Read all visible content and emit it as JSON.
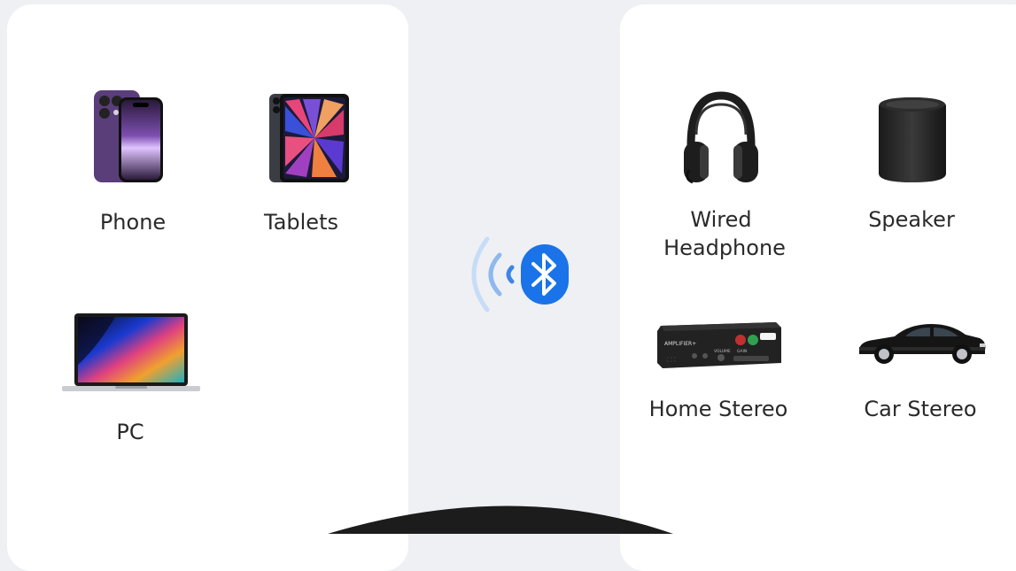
{
  "source_devices": [
    {
      "label": "Phone",
      "icon": "smartphone-icon"
    },
    {
      "label": "Tablets",
      "icon": "tablet-icon"
    },
    {
      "label": "PC",
      "icon": "laptop-icon"
    }
  ],
  "receiver_devices": [
    {
      "label": "Wired\nHeadphone",
      "label_line1": "Wired",
      "label_line2": "Headphone",
      "icon": "headphone-icon"
    },
    {
      "label": "Speaker",
      "icon": "speaker-icon"
    },
    {
      "label": "Home Stereo",
      "icon": "amplifier-icon"
    },
    {
      "label": "Car Stereo",
      "icon": "car-icon"
    }
  ],
  "center": {
    "icon": "bluetooth-icon",
    "accent_color": "#1a73e8"
  },
  "amplifier_panel": {
    "brand": "AMPLIFIER+",
    "volume": "VOLUME",
    "gain": "GAIN"
  }
}
